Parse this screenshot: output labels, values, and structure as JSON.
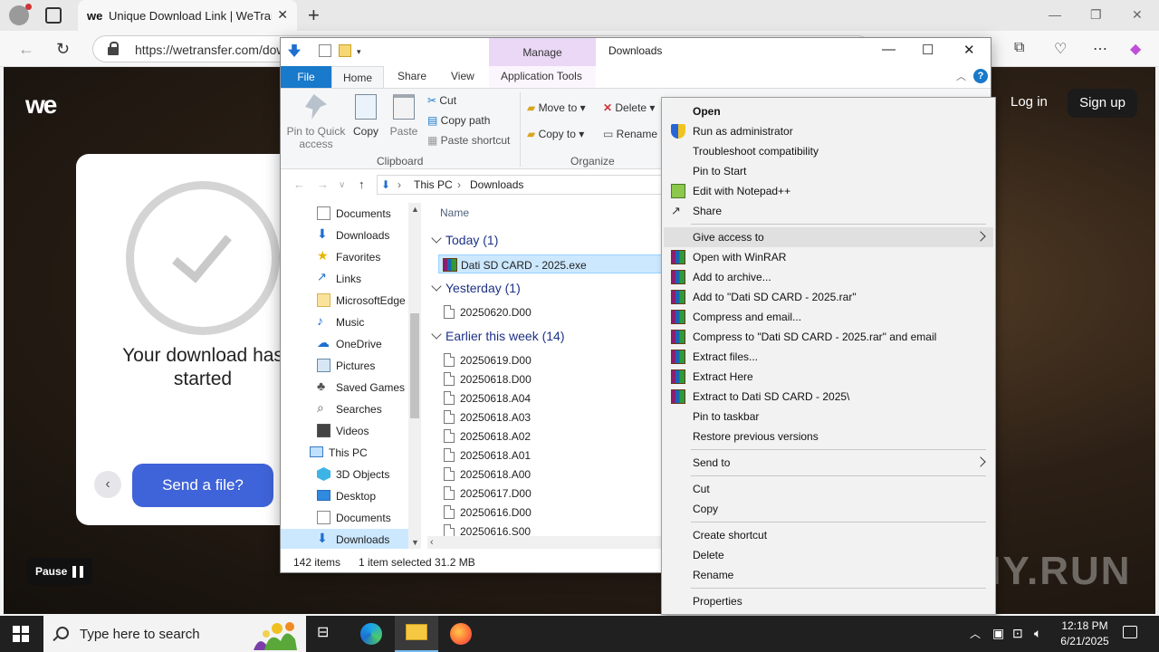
{
  "browser": {
    "tab_title": "Unique Download Link | WeTransfer",
    "tab_favicon": "we",
    "url": "https://wetransfer.com/downloads"
  },
  "wetransfer": {
    "logo": "we",
    "login": "Log in",
    "signup": "Sign up",
    "message": "Your download has started",
    "send_button": "Send a file?",
    "pause": "Pause"
  },
  "explorer": {
    "context_tab": "Manage",
    "window_title": "Downloads",
    "ribbon_tabs": [
      "File",
      "Home",
      "Share",
      "View",
      "Application Tools"
    ],
    "clipboard": {
      "pin": "Pin to Quick access",
      "copy": "Copy",
      "paste": "Paste",
      "cut": "Cut",
      "copy_path": "Copy path",
      "paste_shortcut": "Paste shortcut",
      "label": "Clipboard"
    },
    "organize": {
      "move_to": "Move to",
      "copy_to": "Copy to",
      "delete": "Delete",
      "rename": "Rename",
      "label": "Organize"
    },
    "path": [
      "This PC",
      "Downloads"
    ],
    "nav_items": [
      {
        "label": "Documents",
        "icon": "documents-icon"
      },
      {
        "label": "Downloads",
        "icon": "downloads-icon"
      },
      {
        "label": "Favorites",
        "icon": "star-icon"
      },
      {
        "label": "Links",
        "icon": "links-icon"
      },
      {
        "label": "MicrosoftEdge",
        "icon": "folder-icon"
      },
      {
        "label": "Music",
        "icon": "music-icon"
      },
      {
        "label": "OneDrive",
        "icon": "cloud-icon"
      },
      {
        "label": "Pictures",
        "icon": "pictures-icon"
      },
      {
        "label": "Saved Games",
        "icon": "games-icon"
      },
      {
        "label": "Searches",
        "icon": "search-icon"
      },
      {
        "label": "Videos",
        "icon": "videos-icon"
      },
      {
        "label": "This PC",
        "icon": "computer-icon"
      },
      {
        "label": "3D Objects",
        "icon": "cube-icon"
      },
      {
        "label": "Desktop",
        "icon": "desktop-icon"
      },
      {
        "label": "Documents",
        "icon": "documents-icon"
      },
      {
        "label": "Downloads",
        "icon": "downloads-icon"
      }
    ],
    "column_name": "Name",
    "groups": {
      "today": "Today (1)",
      "yesterday": "Yesterday (1)",
      "week": "Earlier this week (14)"
    },
    "files_today": [
      "Dati SD CARD - 2025.exe"
    ],
    "files_yesterday": [
      "20250620.D00"
    ],
    "files_week": [
      "20250619.D00",
      "20250618.D00",
      "20250618.A04",
      "20250618.A03",
      "20250618.A02",
      "20250618.A01",
      "20250618.A00",
      "20250617.D00",
      "20250616.D00",
      "20250616.S00"
    ],
    "status": {
      "count": "142 items",
      "selection": "1 item selected  31.2 MB"
    }
  },
  "context_menu": {
    "items": [
      {
        "label": "Open",
        "bold": true,
        "icon": ""
      },
      {
        "label": "Run as administrator",
        "icon": "shield-icon"
      },
      {
        "label": "Troubleshoot compatibility",
        "icon": ""
      },
      {
        "label": "Pin to Start",
        "icon": ""
      },
      {
        "label": "Edit with Notepad++",
        "icon": "notepad-icon"
      },
      {
        "label": "Share",
        "icon": "share-icon"
      },
      {
        "label": "Give access to",
        "icon": "",
        "submenu": true
      },
      {
        "label": "Open with WinRAR",
        "icon": "winrar-icon"
      },
      {
        "label": "Add to archive...",
        "icon": "winrar-icon"
      },
      {
        "label": "Add to \"Dati SD CARD - 2025.rar\"",
        "icon": "winrar-icon"
      },
      {
        "label": "Compress and email...",
        "icon": "winrar-icon"
      },
      {
        "label": "Compress to \"Dati SD CARD - 2025.rar\" and email",
        "icon": "winrar-icon"
      },
      {
        "label": "Extract files...",
        "icon": "winrar-icon"
      },
      {
        "label": "Extract Here",
        "icon": "winrar-icon"
      },
      {
        "label": "Extract to Dati SD CARD - 2025\\",
        "icon": "winrar-icon"
      },
      {
        "label": "Pin to taskbar",
        "icon": ""
      },
      {
        "label": "Restore previous versions",
        "icon": ""
      },
      {
        "label": "Send to",
        "icon": "",
        "submenu": true
      },
      {
        "label": "Cut",
        "icon": ""
      },
      {
        "label": "Copy",
        "icon": ""
      },
      {
        "label": "Create shortcut",
        "icon": ""
      },
      {
        "label": "Delete",
        "icon": ""
      },
      {
        "label": "Rename",
        "icon": ""
      },
      {
        "label": "Properties",
        "icon": ""
      }
    ]
  },
  "watermark": "ANY.RUN",
  "taskbar": {
    "search_placeholder": "Type here to search",
    "time": "12:18 PM",
    "date": "6/21/2025"
  },
  "colors": {
    "file_tab": "#1979ca",
    "manage_tab": "#ead8f6",
    "selection": "#cce8ff",
    "send_button": "#3f63d8"
  }
}
